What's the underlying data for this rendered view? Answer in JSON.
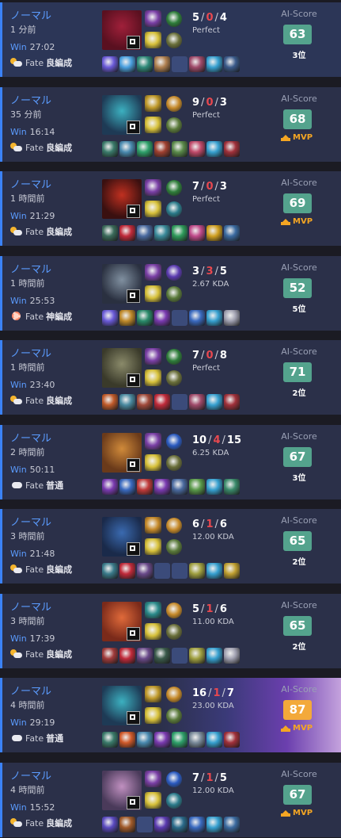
{
  "matches": [
    {
      "mode": "ノーマル",
      "ago": "1 分前",
      "result": "Win",
      "duration": "27:02",
      "fate_label": "Fate",
      "fate": "良編成",
      "weather": "sun-cloud",
      "champ_colors": [
        "#5a1020",
        "#a0203a"
      ],
      "spells": [
        "#7a3fa6",
        "#2e7d3a",
        "#d7c13a",
        "#6a6f3a"
      ],
      "kills": "5",
      "deaths": "0",
      "assists": "4",
      "kda_text": "Perfect",
      "score": "63",
      "rank": "3位",
      "mvp": false,
      "highlight": "first",
      "items": [
        "#6a5ad8",
        "#4aa0e0",
        "#2f8a7a",
        "#b08050",
        "empty",
        "#a04a6a",
        "#36a0d0",
        "#3a5a8a"
      ]
    },
    {
      "mode": "ノーマル",
      "ago": "35 分前",
      "result": "Win",
      "duration": "16:14",
      "fate_label": "Fate",
      "fate": "良編成",
      "weather": "sun-cloud",
      "champ_colors": [
        "#1e3a55",
        "#3cb0c0"
      ],
      "spells": [
        "#c09a2a",
        "#c68a2a",
        "#d7c13a",
        "#5a7a3a"
      ],
      "kills": "9",
      "deaths": "0",
      "assists": "3",
      "kda_text": "Perfect",
      "score": "68",
      "rank": "MVP",
      "mvp": true,
      "highlight": "",
      "items": [
        "#3a7a6a",
        "#4a8ab0",
        "#2ea06a",
        "#a04030",
        "#5a8a4a",
        "#c04a6a",
        "#36a0d0",
        "#a0303a"
      ]
    },
    {
      "mode": "ノーマル",
      "ago": "1 時間前",
      "result": "Win",
      "duration": "21:29",
      "fate_label": "Fate",
      "fate": "良編成",
      "weather": "sun-cloud",
      "champ_colors": [
        "#3a1010",
        "#c03020"
      ],
      "spells": [
        "#7a3fa6",
        "#2e7d3a",
        "#d7c13a",
        "#2a7a8a"
      ],
      "kills": "7",
      "deaths": "0",
      "assists": "3",
      "kda_text": "Perfect",
      "score": "69",
      "rank": "MVP",
      "mvp": true,
      "highlight": "",
      "items": [
        "#3a6a5a",
        "#c02a3a",
        "#4a6aa0",
        "#3a8a9a",
        "#2e9a5a",
        "#c04a8a",
        "#d0a020",
        "#3a6aa0"
      ]
    },
    {
      "mode": "ノーマル",
      "ago": "1 時間前",
      "result": "Win",
      "duration": "25:53",
      "fate_label": "Fate",
      "fate": "神編成",
      "weather": "gear",
      "champ_colors": [
        "#2a3040",
        "#8090a0"
      ],
      "spells": [
        "#7a3fa6",
        "#5a3ab0",
        "#d7c13a",
        "#5a7a3a"
      ],
      "kills": "3",
      "deaths": "3",
      "assists": "5",
      "kda_text": "2.67 KDA",
      "score": "52",
      "rank": "5位",
      "mvp": false,
      "highlight": "",
      "items": [
        "#6a5ad8",
        "#c08a2a",
        "#2a8a6a",
        "#7a3ab0",
        "empty",
        "#3a6ac0",
        "#36a0d0",
        "#a0a0b0"
      ]
    },
    {
      "mode": "ノーマル",
      "ago": "1 時間前",
      "result": "Win",
      "duration": "23:40",
      "fate_label": "Fate",
      "fate": "良編成",
      "weather": "sun-cloud",
      "champ_colors": [
        "#3a3a2a",
        "#8a8a6a"
      ],
      "spells": [
        "#7a3fa6",
        "#2e7d3a",
        "#d7c13a",
        "#6a6f3a"
      ],
      "kills": "7",
      "deaths": "0",
      "assists": "8",
      "kda_text": "Perfect",
      "score": "71",
      "rank": "2位",
      "mvp": false,
      "highlight": "",
      "items": [
        "#c05a2a",
        "#4a8aa0",
        "#a04a3a",
        "#c02a3a",
        "empty",
        "#a04a6a",
        "#36a0d0",
        "#a0303a"
      ]
    },
    {
      "mode": "ノーマル",
      "ago": "2 時間前",
      "result": "Win",
      "duration": "50:11",
      "fate_label": "Fate",
      "fate": "普通",
      "weather": "cloud",
      "champ_colors": [
        "#6a3a1a",
        "#d08a3a"
      ],
      "spells": [
        "#7a3fa6",
        "#2a5ac0",
        "#d7c13a",
        "#6a6f3a"
      ],
      "kills": "10",
      "deaths": "4",
      "assists": "15",
      "kda_text": "6.25 KDA",
      "score": "67",
      "rank": "3位",
      "mvp": false,
      "highlight": "",
      "items": [
        "#7a3ab0",
        "#3a6ac0",
        "#c03a3a",
        "#7a3ab0",
        "#4a6aa0",
        "#5a9a4a",
        "#36a0d0",
        "#3a8a6a"
      ]
    },
    {
      "mode": "ノーマル",
      "ago": "3 時間前",
      "result": "Win",
      "duration": "21:48",
      "fate_label": "Fate",
      "fate": "良編成",
      "weather": "sun-cloud",
      "champ_colors": [
        "#1a2a4a",
        "#3a6ab0"
      ],
      "spells": [
        "#c68a2a",
        "#c68a2a",
        "#d7c13a",
        "#5a7a3a"
      ],
      "kills": "6",
      "deaths": "1",
      "assists": "6",
      "kda_text": "12.00 KDA",
      "score": "65",
      "rank": "2位",
      "mvp": false,
      "highlight": "",
      "items": [
        "#3a7a8a",
        "#c02a3a",
        "#6a4a8a",
        "empty",
        "empty",
        "#a0a040",
        "#36a0d0",
        "#c0a030"
      ]
    },
    {
      "mode": "ノーマル",
      "ago": "3 時間前",
      "result": "Win",
      "duration": "17:39",
      "fate_label": "Fate",
      "fate": "良編成",
      "weather": "sun-cloud",
      "champ_colors": [
        "#7a2a1a",
        "#e06a3a"
      ],
      "spells": [
        "#2a8a8a",
        "#c68a2a",
        "#d7c13a",
        "#6a6f3a"
      ],
      "kills": "5",
      "deaths": "1",
      "assists": "6",
      "kda_text": "11.00 KDA",
      "score": "65",
      "rank": "2位",
      "mvp": false,
      "highlight": "",
      "items": [
        "#a03a3a",
        "#c02a3a",
        "#6a4a8a",
        "#3a5a4a",
        "empty",
        "#a0a040",
        "#36a0d0",
        "#a0a0b0"
      ]
    },
    {
      "mode": "ノーマル",
      "ago": "4 時間前",
      "result": "Win",
      "duration": "29:19",
      "fate_label": "Fate",
      "fate": "普通",
      "weather": "cloud",
      "champ_colors": [
        "#1e3a55",
        "#3cb0c0"
      ],
      "spells": [
        "#c09a2a",
        "#c68a2a",
        "#d7c13a",
        "#5a7a3a"
      ],
      "kills": "16",
      "deaths": "1",
      "assists": "7",
      "kda_text": "23.00 KDA",
      "score": "87",
      "rank": "MVP",
      "mvp": true,
      "highlight": "mvp",
      "items": [
        "#3a7a6a",
        "#d05a2a",
        "#4a8ab0",
        "#7a3ab0",
        "#2ea06a",
        "#7a8a9a",
        "#36a0d0",
        "#a0303a"
      ]
    },
    {
      "mode": "ノーマル",
      "ago": "4 時間前",
      "result": "Win",
      "duration": "15:52",
      "fate_label": "Fate",
      "fate": "良編成",
      "weather": "sun-cloud",
      "champ_colors": [
        "#4a3a5a",
        "#c090c0"
      ],
      "spells": [
        "#7a3fa6",
        "#2a5ac0",
        "#d7c13a",
        "#2a7a8a"
      ],
      "kills": "7",
      "deaths": "1",
      "assists": "5",
      "kda_text": "12.00 KDA",
      "score": "67",
      "rank": "MVP",
      "mvp": true,
      "highlight": "",
      "items": [
        "#5a4ac0",
        "#a05a2a",
        "empty",
        "#5a3ab0",
        "#2a6a8a",
        "#3a6ac0",
        "#36a0d0",
        "#3a6aa0"
      ]
    }
  ],
  "ai_score_label": "AI-Score"
}
